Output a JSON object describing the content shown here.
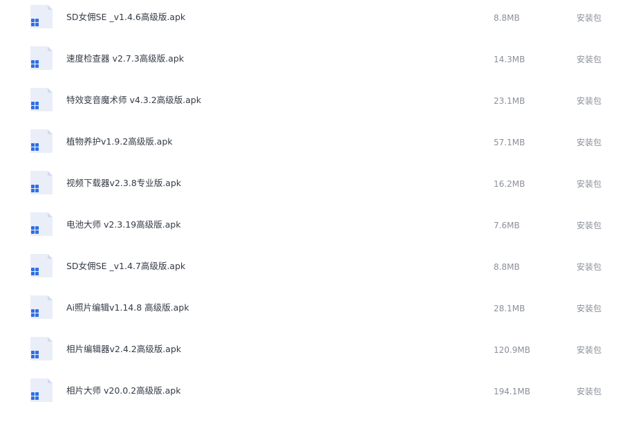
{
  "files": [
    {
      "name": "SD女佣SE _v1.4.6高级版.apk",
      "size": "8.8MB",
      "type": "安装包",
      "icon": "apk-file-icon"
    },
    {
      "name": "速度检查器  v2.7.3高级版.apk",
      "size": "14.3MB",
      "type": "安装包",
      "icon": "apk-file-icon"
    },
    {
      "name": "特效变音魔术师 v4.3.2高级版.apk",
      "size": "23.1MB",
      "type": "安装包",
      "icon": "apk-file-icon"
    },
    {
      "name": "植物养护v1.9.2高级版.apk",
      "size": "57.1MB",
      "type": "安装包",
      "icon": "apk-file-icon"
    },
    {
      "name": "视频下载器v2.3.8专业版.apk",
      "size": "16.2MB",
      "type": "安装包",
      "icon": "apk-file-icon"
    },
    {
      "name": "电池大师 v2.3.19高级版.apk",
      "size": "7.6MB",
      "type": "安装包",
      "icon": "apk-file-icon"
    },
    {
      "name": "SD女佣SE _v1.4.7高级版.apk",
      "size": "8.8MB",
      "type": "安装包",
      "icon": "apk-file-icon"
    },
    {
      "name": "Ai照片编辑v1.14.8 高级版.apk",
      "size": "28.1MB",
      "type": "安装包",
      "icon": "apk-file-icon"
    },
    {
      "name": "相片编辑器v2.4.2高级版.apk",
      "size": "120.9MB",
      "type": "安装包",
      "icon": "apk-file-icon"
    },
    {
      "name": "相片大师 v20.0.2高级版.apk",
      "size": "194.1MB",
      "type": "安装包",
      "icon": "apk-file-icon"
    }
  ],
  "colors": {
    "icon_body": "#e9eef8",
    "icon_fold": "#d3dcee",
    "icon_grid": "#2f6fe4"
  }
}
